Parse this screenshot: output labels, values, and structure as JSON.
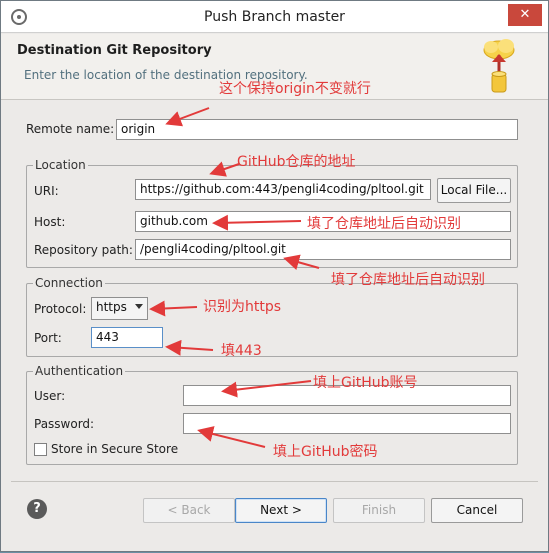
{
  "window": {
    "title": "Push Branch master",
    "close_glyph": "✕"
  },
  "banner": {
    "heading": "Destination Git Repository",
    "description": "Enter the location of the destination repository."
  },
  "remote": {
    "label": "Remote name:",
    "value": "origin"
  },
  "location": {
    "legend": "Location",
    "uri_label": "URI:",
    "uri_value": "https://github.com:443/pengli4coding/pltool.git",
    "local_file_button": "Local File...",
    "host_label": "Host:",
    "host_value": "github.com",
    "repo_path_label": "Repository path:",
    "repo_path_value": "/pengli4coding/pltool.git"
  },
  "connection": {
    "legend": "Connection",
    "protocol_label": "Protocol:",
    "protocol_value": "https",
    "port_label": "Port:",
    "port_value": "443"
  },
  "authentication": {
    "legend": "Authentication",
    "user_label": "User:",
    "user_value": "",
    "password_label": "Password:",
    "password_value": "",
    "store_label": "Store in Secure Store",
    "store_checked": false
  },
  "buttons": {
    "back": "< Back",
    "next": "Next >",
    "finish": "Finish",
    "cancel": "Cancel",
    "help_glyph": "?"
  },
  "annotations": {
    "remote": "这个保持origin不变就行",
    "uri": "GitHub仓库的地址",
    "host": "填了仓库地址后自动识别",
    "repo_path": "填了仓库地址后自动识别",
    "protocol": "识别为https",
    "port": "填443",
    "user": "填上GitHub账号",
    "password": "填上GitHub密码",
    "color": "#e23a3a"
  }
}
